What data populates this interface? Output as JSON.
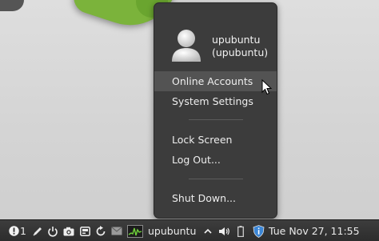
{
  "menu": {
    "user_display": "upubuntu",
    "user_login": "(upubuntu)",
    "items": [
      {
        "label": "Online Accounts"
      },
      {
        "label": "System Settings"
      },
      {
        "label": "Lock Screen"
      },
      {
        "label": "Log Out..."
      },
      {
        "label": "Shut Down..."
      }
    ]
  },
  "taskbar": {
    "notification_count": "1",
    "window_title": "upubuntu",
    "clock": "Tue Nov 27, 11:55"
  },
  "icons": {
    "alert": "alert-icon",
    "pen": "pen-icon",
    "power": "power-icon",
    "camera": "camera-icon",
    "screen": "screen-icon",
    "refresh": "refresh-icon",
    "mail": "mail-icon",
    "monitor": "system-monitor-icon",
    "chevron": "chevron-up-icon",
    "volume": "volume-icon",
    "battery": "battery-icon",
    "shield": "shield-icon"
  },
  "colors": {
    "menu_bg": "#3c3c3c",
    "menu_hover": "#535353",
    "taskbar_bg": "#333333",
    "accent_green": "#7bb33b"
  }
}
